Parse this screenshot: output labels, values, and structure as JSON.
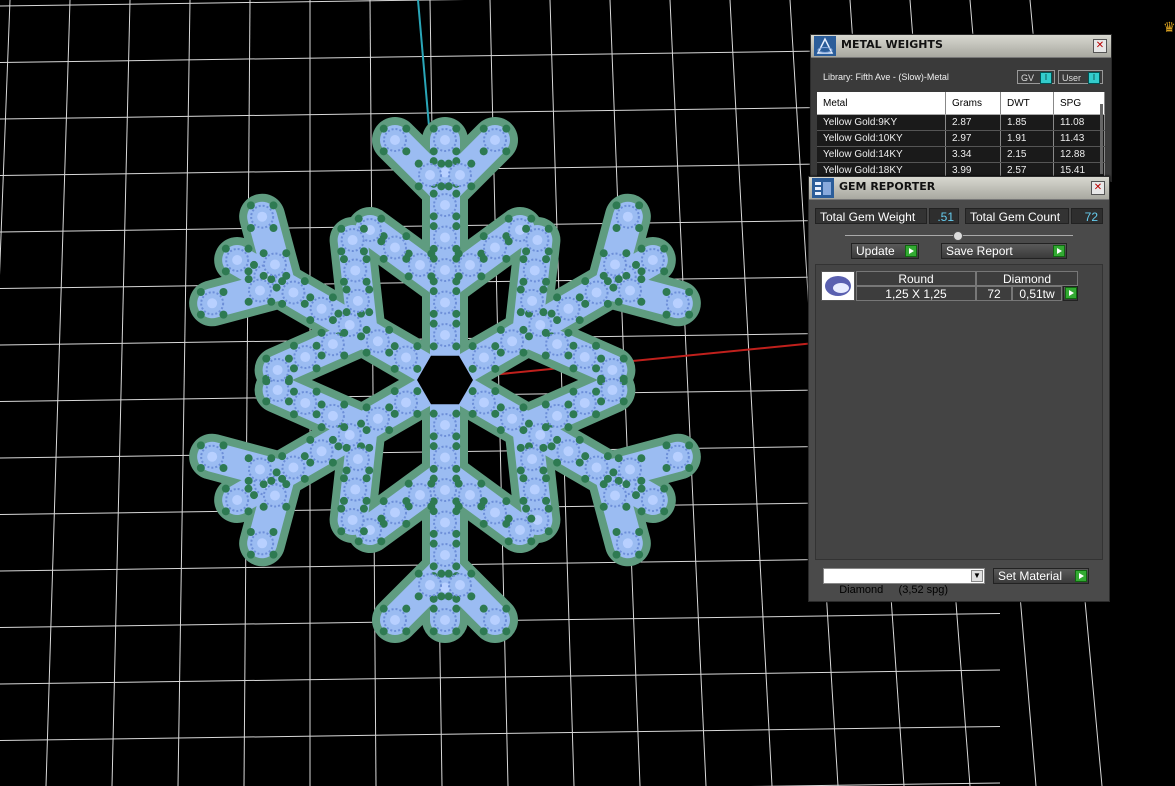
{
  "metal_weights": {
    "title": "METAL WEIGHTS",
    "library": "Library: Fifth Ave - (Slow)-Metal",
    "toggles": [
      "GV",
      "User"
    ],
    "columns": [
      "Metal",
      "Grams",
      "DWT",
      "SPG"
    ],
    "rows": [
      [
        "Yellow Gold:9KY",
        "2.87",
        "1.85",
        "11.08"
      ],
      [
        "Yellow Gold:10KY",
        "2.97",
        "1.91",
        "11.43"
      ],
      [
        "Yellow Gold:14KY",
        "3.34",
        "2.15",
        "12.88"
      ],
      [
        "Yellow Gold:18KY",
        "3.99",
        "2.57",
        "15.41"
      ]
    ]
  },
  "gem_reporter": {
    "title": "GEM REPORTER",
    "total_weight_label": "Total Gem Weight",
    "total_weight_value": ".51",
    "total_count_label": "Total Gem Count",
    "total_count_value": "72",
    "update_label": "Update",
    "save_report_label": "Save Report",
    "gem": {
      "shape": "Round",
      "material": "Diamond",
      "size": "1,25 X 1,25",
      "count": "72",
      "weight": "0,51tw"
    },
    "material_select": "Diamond     (3,52 spg)",
    "set_material_label": "Set Material"
  },
  "colors": {
    "gem_blue": "#9bbcf2",
    "metal_green": "#5f9c80",
    "prong_green": "#2e7a52",
    "grid": "#ffffff"
  }
}
